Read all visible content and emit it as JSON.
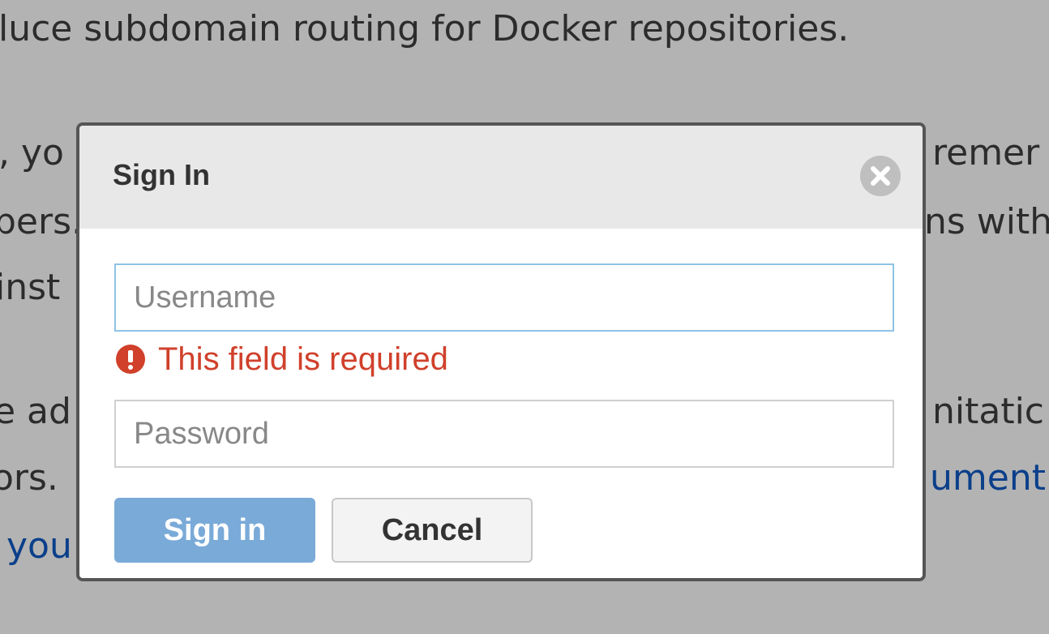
{
  "background": {
    "lines": [
      "luce subdomain routing for Docker repositories.",
      ", yo",
      "remer",
      "pers.",
      "ns with",
      "inst",
      "e ad",
      "nitatic",
      "ors.",
      "ument",
      "you"
    ]
  },
  "dialog": {
    "title": "Sign In",
    "username": {
      "placeholder": "Username",
      "value": "",
      "error": "This field is required"
    },
    "password": {
      "placeholder": "Password",
      "value": ""
    },
    "buttons": {
      "sign_in": "Sign in",
      "cancel": "Cancel"
    }
  },
  "colors": {
    "overlay": "#b3b3b3",
    "error": "#d0402b",
    "primary_button": "#7aaad8",
    "link": "#0b3f8a"
  },
  "icons": {
    "close": "close-icon",
    "error": "exclamation-circle-icon"
  }
}
